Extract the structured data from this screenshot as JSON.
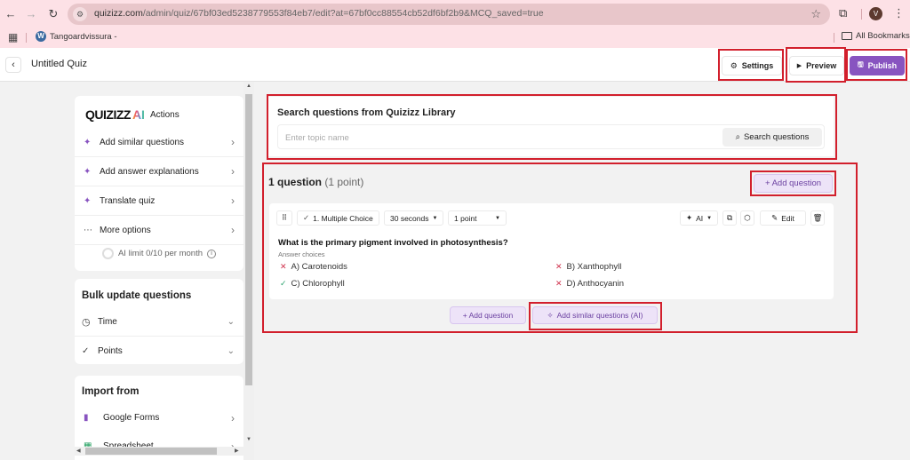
{
  "browser": {
    "url_domain": "quizizz.com",
    "url_path": "/admin/quiz/67bf03ed5238779553f84eb7/edit?at=67bf0cc88554cb52df6bf2b9&MCQ_saved=true",
    "avatar_letter": "V",
    "bookmark_item": "Tangoardvissura -",
    "all_bookmarks": "All Bookmarks",
    "icons": {
      "back": "arrow-left-icon",
      "forward": "arrow-right-icon",
      "reload": "reload-icon",
      "star": "star-icon",
      "extensions": "puzzle-icon",
      "menu": "kebab-icon",
      "apps": "apps-grid-icon"
    }
  },
  "header": {
    "title": "Untitled Quiz",
    "settings_label": "Settings",
    "preview_label": "Preview",
    "publish_label": "Publish",
    "accent_color": "#8854c0"
  },
  "sidebar": {
    "logo_text": "QUIZIZZ",
    "logo_ai": "AI",
    "actions_label": "Actions",
    "ai_actions": [
      {
        "label": "Add similar questions",
        "icon": "sparkle-icon"
      },
      {
        "label": "Add answer explanations",
        "icon": "sparkle-icon"
      },
      {
        "label": "Translate quiz",
        "icon": "sparkle-icon"
      },
      {
        "label": "More options",
        "icon": "ellipsis-icon"
      }
    ],
    "ai_limit": "AI limit 0/10 per month",
    "bulk_update": {
      "title": "Bulk update questions",
      "items": [
        {
          "label": "Time",
          "icon": "clock-icon"
        },
        {
          "label": "Points",
          "icon": "check-icon"
        }
      ]
    },
    "import": {
      "title": "Import from",
      "items": [
        {
          "label": "Google Forms",
          "icon": "google-forms-icon"
        },
        {
          "label": "Spreadsheet",
          "icon": "spreadsheet-icon"
        }
      ]
    }
  },
  "search": {
    "title": "Search questions from Quizizz Library",
    "placeholder": "Enter topic name",
    "value": "",
    "button_label": "Search questions"
  },
  "questions": {
    "count_label": "1 question",
    "points_label": "(1 point)",
    "add_question_label": "+ Add question",
    "items": [
      {
        "type_label": "1. Multiple Choice",
        "time": "30 seconds",
        "points": "1 point",
        "ai_label": "AI",
        "edit_label": "Edit",
        "text": "What is the primary pigment involved in photosynthesis?",
        "answer_choices_label": "Answer choices",
        "choices": [
          {
            "label": "A) Carotenoids",
            "correct": false
          },
          {
            "label": "B) Xanthophyll",
            "correct": false
          },
          {
            "label": "C) Chlorophyll",
            "correct": true
          },
          {
            "label": "D) Anthocyanin",
            "correct": false
          }
        ]
      }
    ],
    "bottom_add_question": "+ Add question",
    "bottom_add_similar": "Add similar questions (AI)"
  }
}
